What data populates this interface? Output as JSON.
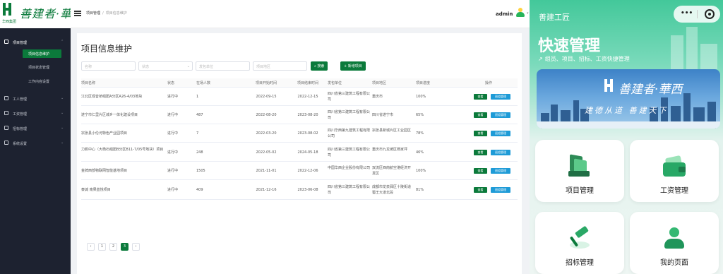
{
  "brand": {
    "logo_script": "善建者·華西",
    "logo_sub": "华西集团"
  },
  "topbar": {
    "breadcrumb": [
      "项目管理",
      "项目信息维护"
    ],
    "user": "admin"
  },
  "sidebar": {
    "groups": [
      {
        "label": "项目管理",
        "icon": "project-icon",
        "open": true,
        "items": [
          "项目信息维护",
          "项目状态管理",
          "工作内容设置"
        ]
      },
      {
        "label": "工人管理",
        "icon": "worker-icon"
      },
      {
        "label": "工资管理",
        "icon": "salary-icon"
      },
      {
        "label": "招标管理",
        "icon": "bidding-icon"
      },
      {
        "label": "系统设置",
        "icon": "settings-icon"
      }
    ],
    "active_item": "项目信息维护"
  },
  "page": {
    "title": "项目信息维护",
    "filters": {
      "name_placeholder": "名称",
      "status_placeholder": "状态",
      "issuer_placeholder": "发包单位",
      "region_placeholder": "项目地区"
    },
    "search_label": "搜索",
    "add_label": "+ 新增项目"
  },
  "table": {
    "headers": [
      "项目名称",
      "状态",
      "在场人数",
      "项目开始时间",
      "项目结束时间",
      "发包单位",
      "项目地区",
      "项目进度",
      "操作"
    ],
    "rows": [
      [
        "江北区观音桥组团A分区A26-4/03地块",
        "进行中",
        "1",
        "2022-09-15",
        "2022-12-15",
        "四川省第三建筑工程有限公司",
        "重庆市",
        "100%"
      ],
      [
        "遂宁市仁里片区城乡一体化建设项目",
        "进行中",
        "487",
        "2022-08-20",
        "2023-08-20",
        "四川省第三建筑工程有限公司",
        "四川省遂宁市",
        "65%"
      ],
      [
        "宗张县小伦河特色产业园项目",
        "进行中",
        "7",
        "2022-03-20",
        "2023-08-02",
        "四川华西第九建筑工程有限公司",
        "宗张县新城片区工业园区",
        "78%"
      ],
      [
        "力帆中心（大杨石组团B分区B11-7/05号地块）项目",
        "进行中",
        "248",
        "2022-05-02",
        "2024-05-18",
        "四川省第三建筑工程有限公司",
        "重庆市九龙坡区杨家坪",
        "46%"
      ],
      [
        "金牌西部物联网智能基地项目",
        "进行中",
        "1505",
        "2021-11-01",
        "2022-12-06",
        "中国华西企业股份有限公司",
        "双流区西南航空港经济开发区",
        "100%"
      ],
      [
        "泰诚 南果蓝悦项目",
        "进行中",
        "409",
        "2021-12-16",
        "2023-06-08",
        "四川省第三建筑工程有限公司",
        "成都市龙泉驿区十陵街道蜀王大道北段",
        "81%"
      ]
    ],
    "view_label": "查看",
    "manage_label": "班组管理"
  },
  "pagination": {
    "prev": "‹",
    "pages": [
      "1",
      "2",
      "3"
    ],
    "current": "3",
    "next": "›"
  },
  "mobile": {
    "title": "善建工匠",
    "hero_title": "快速管理",
    "hero_arrow": "↗",
    "hero_sub": "组员、项目、招标、工资快捷管理",
    "banner_script": "善建者·華西",
    "banner_slogan": "建德从道 善建天下",
    "cards": [
      {
        "label": "项目管理",
        "icon": "project-stack-icon"
      },
      {
        "label": "工资管理",
        "icon": "wallet-icon"
      },
      {
        "label": "招标管理",
        "icon": "gavel-icon"
      },
      {
        "label": "我的页面",
        "icon": "profile-icon"
      }
    ],
    "capsule_dots": "•••"
  },
  "colors": {
    "brand_green": "#0b7a3b",
    "manage_blue": "#1e9bd7",
    "sidebar_bg": "#1d2230",
    "mobile_green": "#43c89a"
  }
}
